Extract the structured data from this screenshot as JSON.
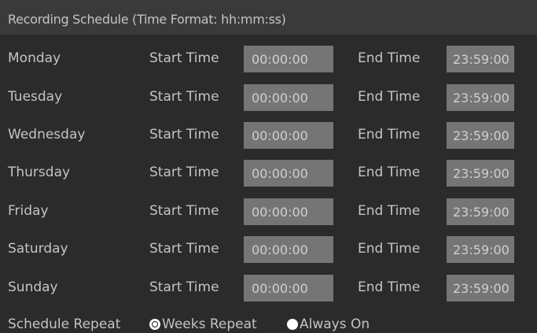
{
  "title": "Recording Schedule (Time Format: hh:mm:ss)",
  "start_label": "Start Time",
  "end_label": "End Time",
  "days": [
    {
      "day": "Monday",
      "start": "00:00:00",
      "end": "23:59:00"
    },
    {
      "day": "Tuesday",
      "start": "00:00:00",
      "end": "23:59:00"
    },
    {
      "day": "Wednesday",
      "start": "00:00:00",
      "end": "23:59:00"
    },
    {
      "day": "Thursday",
      "start": "00:00:00",
      "end": "23:59:00"
    },
    {
      "day": "Friday",
      "start": "00:00:00",
      "end": "23:59:00"
    },
    {
      "day": "Saturday",
      "start": "00:00:00",
      "end": "23:59:00"
    },
    {
      "day": "Sunday",
      "start": "00:00:00",
      "end": "23:59:00"
    }
  ],
  "repeat": {
    "label": "Schedule Repeat",
    "options": [
      {
        "label": "Weeks Repeat",
        "selected": true
      },
      {
        "label": "Always On",
        "selected": false
      }
    ]
  },
  "colors": {
    "background": "#2b2b2b",
    "title_bar": "#3a3a3a",
    "field": "#757575",
    "text": "#c4c4c4"
  }
}
